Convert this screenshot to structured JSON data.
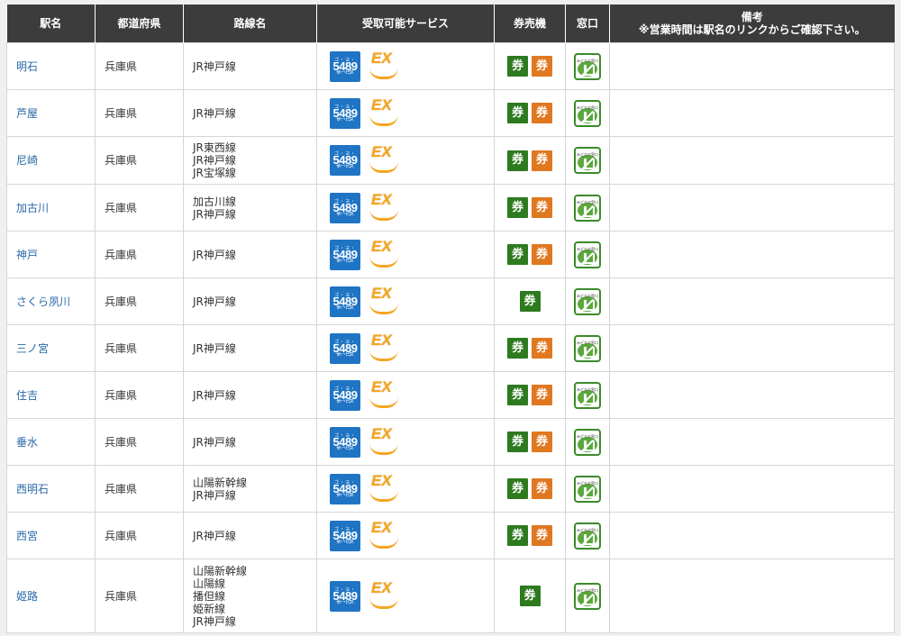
{
  "headers": {
    "station": "駅名",
    "prefecture": "都道府県",
    "lines": "路線名",
    "services": "受取可能サービス",
    "machine": "券売機",
    "window": "窓口",
    "notes_title": "備考",
    "notes_sub": "※営業時間は駅名のリンクからご確認下さい。"
  },
  "icons": {
    "service_5489_top": "ゴ・ヨ・ハ・ク",
    "service_5489_num": "5489",
    "service_5489_bot": "サービス",
    "service_ex": "EX",
    "ticket_glyph": "券",
    "window_label": "みどりの窓口"
  },
  "colors": {
    "header_bg": "#3c3c3c",
    "link": "#2a6aa8",
    "ticket_green": "#2d7a1f",
    "ticket_orange": "#e07820",
    "blue_5489": "#1f74c4",
    "ex_orange": "#f5a623"
  },
  "rows": [
    {
      "station": "明石",
      "prefecture": "兵庫県",
      "lines": [
        "JR神戸線"
      ],
      "tickets": 2
    },
    {
      "station": "芦屋",
      "prefecture": "兵庫県",
      "lines": [
        "JR神戸線"
      ],
      "tickets": 2
    },
    {
      "station": "尼崎",
      "prefecture": "兵庫県",
      "lines": [
        "JR東西線",
        "JR神戸線",
        "JR宝塚線"
      ],
      "tickets": 2
    },
    {
      "station": "加古川",
      "prefecture": "兵庫県",
      "lines": [
        "加古川線",
        "JR神戸線"
      ],
      "tickets": 2
    },
    {
      "station": "神戸",
      "prefecture": "兵庫県",
      "lines": [
        "JR神戸線"
      ],
      "tickets": 2
    },
    {
      "station": "さくら夙川",
      "prefecture": "兵庫県",
      "lines": [
        "JR神戸線"
      ],
      "tickets": 1
    },
    {
      "station": "三ノ宮",
      "prefecture": "兵庫県",
      "lines": [
        "JR神戸線"
      ],
      "tickets": 2
    },
    {
      "station": "住吉",
      "prefecture": "兵庫県",
      "lines": [
        "JR神戸線"
      ],
      "tickets": 2
    },
    {
      "station": "垂水",
      "prefecture": "兵庫県",
      "lines": [
        "JR神戸線"
      ],
      "tickets": 2
    },
    {
      "station": "西明石",
      "prefecture": "兵庫県",
      "lines": [
        "山陽新幹線",
        "JR神戸線"
      ],
      "tickets": 2
    },
    {
      "station": "西宮",
      "prefecture": "兵庫県",
      "lines": [
        "JR神戸線"
      ],
      "tickets": 2
    },
    {
      "station": "姫路",
      "prefecture": "兵庫県",
      "lines": [
        "山陽新幹線",
        "山陽線",
        "播但線",
        "姫新線",
        "JR神戸線"
      ],
      "tickets": 1
    }
  ]
}
